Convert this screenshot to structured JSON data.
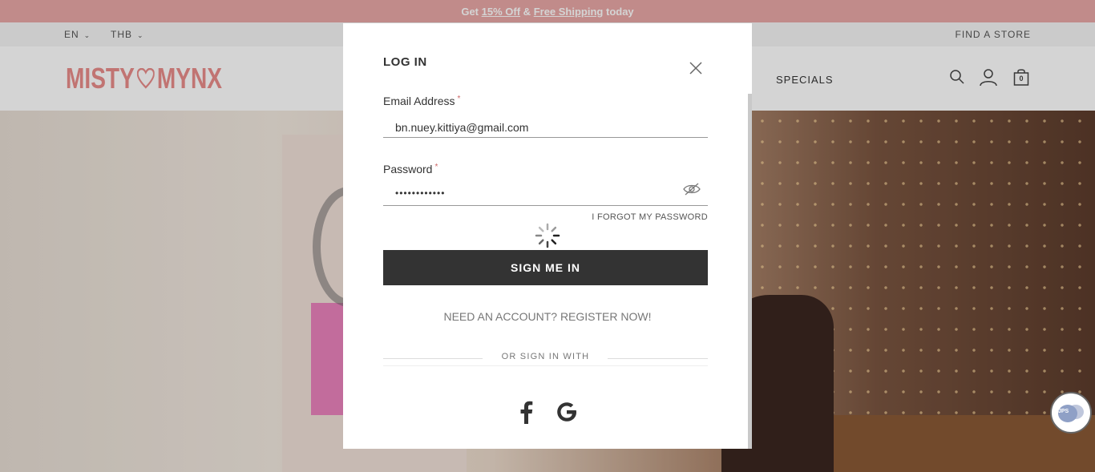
{
  "promo": {
    "prefix": "Get",
    "offer": "15% Off",
    "amp": "&",
    "shipping": "Free Shipping",
    "suffix": "today"
  },
  "utility": {
    "language": "EN",
    "currency": "THB",
    "find_store": "FIND A STORE"
  },
  "header": {
    "logo_left": "MISTY",
    "logo_right": "MYNX",
    "nav_specials": "SPECIALS",
    "cart_count": "0"
  },
  "login": {
    "title": "LOG IN",
    "email_label": "Email Address",
    "email_value": "bn.nuey.kittiya@gmail.com",
    "password_label": "Password",
    "password_value": "••••••••••••",
    "required_mark": "*",
    "forgot": "I FORGOT MY PASSWORD",
    "submit": "SIGN ME IN",
    "register": "NEED AN ACCOUNT? REGISTER NOW!",
    "or_sign_in_with": "OR SIGN IN WITH"
  },
  "chat": {
    "badge": "JPS"
  },
  "colors": {
    "promo_bg": "#e9a8a6",
    "brand_pink": "#e88c8a",
    "button_bg": "#333333"
  }
}
